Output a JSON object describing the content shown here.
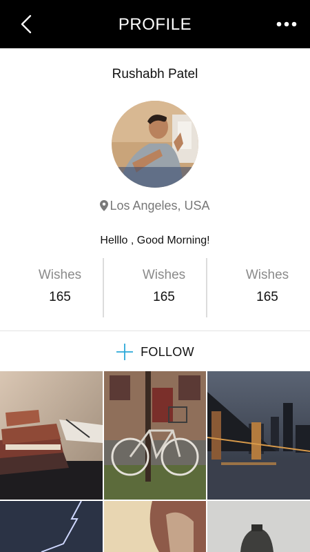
{
  "header": {
    "title": "PROFILE",
    "back_icon": "chevron-left-icon",
    "more_icon": "more-horizontal-icon"
  },
  "profile": {
    "name": "Rushabh Patel",
    "location": "Los Angeles, USA",
    "status": "Helllo , Good Morning!"
  },
  "stats": [
    {
      "label": "Wishes",
      "value": "165"
    },
    {
      "label": "Wishes",
      "value": "165"
    },
    {
      "label": "Wishes",
      "value": "165"
    }
  ],
  "follow": {
    "label": "FOLLOW",
    "icon": "plus-icon"
  },
  "gallery": {
    "photos": [
      "books",
      "bicycle",
      "city-bridge-night",
      "lightning",
      "person-light",
      "statue-sky"
    ]
  },
  "colors": {
    "header_bg": "#000000",
    "accent": "#2aa8d8",
    "muted_text": "#8a8a8a"
  }
}
